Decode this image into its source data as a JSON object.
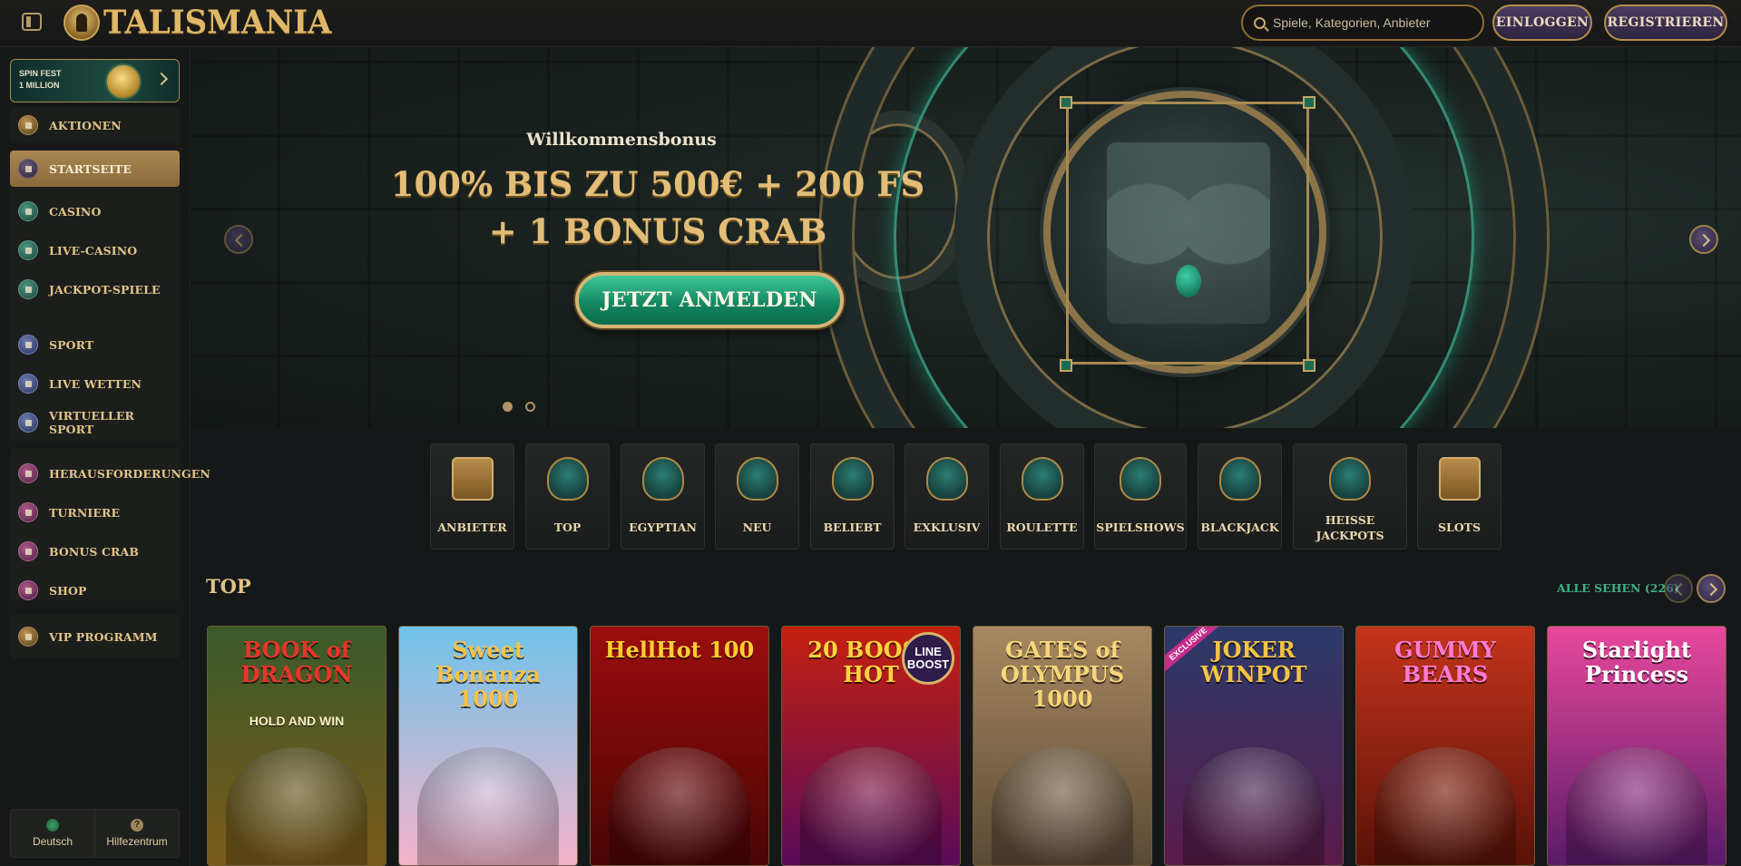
{
  "header": {
    "logo_text": "TALISMANIA",
    "search_placeholder": "Spiele, Kategorien, Anbieter",
    "login_label": "EINLOGGEN",
    "register_label": "REGISTRIEREN"
  },
  "sidebar": {
    "promo": {
      "line1": "SPIN FEST",
      "line2": "1 MILLION"
    },
    "items": [
      {
        "label": "AKTIONEN"
      },
      {
        "label": "STARTSEITE"
      },
      {
        "label": "CASINO"
      },
      {
        "label": "LIVE-CASINO"
      },
      {
        "label": "JACKPOT-SPIELE"
      },
      {
        "label": "SPORT"
      },
      {
        "label": "LIVE WETTEN"
      },
      {
        "label": "VIRTUELLER SPORT"
      },
      {
        "label": "HERAUSFORDERUNGEN"
      },
      {
        "label": "TURNIERE"
      },
      {
        "label": "BONUS CRAB"
      },
      {
        "label": "SHOP"
      },
      {
        "label": "VIP PROGRAMM"
      }
    ],
    "footer": {
      "language": "Deutsch",
      "help": "Hilfezentrum"
    }
  },
  "hero": {
    "subtitle": "Willkommensbonus",
    "title_line1": "100% BIS ZU 500€ + 200 FS",
    "title_line2": "+ 1 BONUS CRAB",
    "cta": "JETZT ANMELDEN",
    "active_slide": 1,
    "slide_count": 2
  },
  "categories": [
    {
      "label": "ANBIETER"
    },
    {
      "label": "TOP"
    },
    {
      "label": "EGYPTIAN"
    },
    {
      "label": "NEU"
    },
    {
      "label": "BELIEBT"
    },
    {
      "label": "EXKLUSIV"
    },
    {
      "label": "ROULETTE"
    },
    {
      "label": "SPIELSHOWS"
    },
    {
      "label": "BLACKJACK"
    },
    {
      "label": "HEISSE JACKPOTS"
    },
    {
      "label": "SLOTS"
    }
  ],
  "top": {
    "title": "TOP",
    "see_all": "ALLE SEHEN (226)",
    "games": [
      {
        "title": "BOOK of DRAGON",
        "sub": "HOLD AND WIN",
        "colors": [
          "#3a5a2a",
          "#7a5a1a"
        ],
        "title_color": "#e8352b"
      },
      {
        "title": "Sweet Bonanza 1000",
        "sub": "",
        "colors": [
          "#6fc3ea",
          "#f4b3c9"
        ],
        "title_color": "#f5c24a"
      },
      {
        "title": "HellHot 100",
        "sub": "",
        "colors": [
          "#9c0d0d",
          "#4a0505"
        ],
        "title_color": "#ffcc33"
      },
      {
        "title": "20 BOOST HOT",
        "sub": "",
        "badge": "LINE BOOST",
        "colors": [
          "#c4200f",
          "#5a0b5a"
        ],
        "title_color": "#ffd23f"
      },
      {
        "title": "GATES of OLYMPUS 1000",
        "sub": "",
        "colors": [
          "#a88860",
          "#5a4a36"
        ],
        "title_color": "#f6d679"
      },
      {
        "title": "JOKER WINPOT",
        "sub": "",
        "badge": "EXCLUSIVE",
        "colors": [
          "#2b3a6a",
          "#5a1a4a"
        ],
        "title_color": "#f5c343"
      },
      {
        "title": "GUMMY BEARS",
        "sub": "",
        "colors": [
          "#c4341c",
          "#5a1208"
        ],
        "title_color": "#ff7ad1"
      },
      {
        "title": "Starlight Princess",
        "sub": "",
        "colors": [
          "#e8489b",
          "#5a1a6a"
        ],
        "title_color": "#ffffff"
      }
    ]
  }
}
